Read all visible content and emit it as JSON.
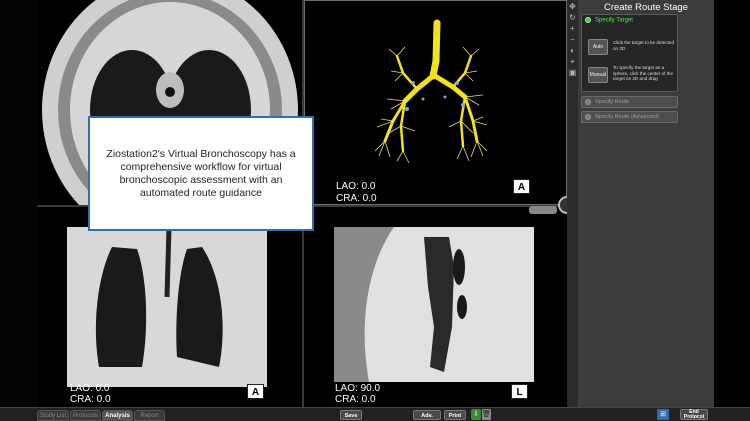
{
  "caption": {
    "text": "Ziostation2's Virtual Bronchoscopy has a comprehensive workflow for virtual bronchoscopic assessment with an automated route guidance"
  },
  "viewports": {
    "volume": {
      "orientation": "A",
      "lao": "LAO: 0.0",
      "cra": "CRA: 0.0"
    },
    "coronal": {
      "orientation": "A",
      "lao": "LAO: 0.0",
      "cra": "CRA: 0.0"
    },
    "sagittal": {
      "orientation": "L",
      "lao": "LAO: 90.0",
      "cra": "CRA: 0.0"
    }
  },
  "route_panel": {
    "title": "Create Route Stage",
    "specify_target": "Specify Target",
    "auto_button": "Auto",
    "auto_desc": "Click the target to be detected on 3D",
    "manual_button": "Manual",
    "manual_desc": "To specify the target as a sphere, click the center of the target on 2D and drag",
    "specify_route": "Specify Route",
    "specify_route_advanced": "Specify Route (Advanced)"
  },
  "bottom_bar": {
    "tabs": [
      "Study List",
      "Protocols",
      "Analysis",
      "Report"
    ],
    "active_tab": "Analysis",
    "save": "Save",
    "adv_movie": "Adv. Movie",
    "print": "Print",
    "end_protocol": "End Protocol"
  },
  "colors": {
    "accent_green": "#3bd23b",
    "caption_border": "#2f6fb8",
    "airway_yellow": "#f2e21a",
    "panel_bg": "#3c3c3c"
  }
}
